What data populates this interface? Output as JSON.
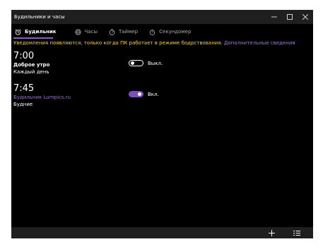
{
  "window": {
    "title": "Будильники и часы"
  },
  "tabs": [
    {
      "label": "Будильник",
      "icon": "alarm-clock-icon",
      "active": true
    },
    {
      "label": "Часы",
      "icon": "world-clock-icon",
      "active": false
    },
    {
      "label": "Таймер",
      "icon": "timer-icon",
      "active": false
    },
    {
      "label": "Секундомер",
      "icon": "stopwatch-icon",
      "active": false
    }
  ],
  "notice": {
    "text": "Уведомления появляются, только когда ПК работает в режиме бодрствования.",
    "link": "Дополнительные сведения"
  },
  "alarms": [
    {
      "time": "7:00",
      "name": "Доброе утро",
      "days": "Каждый день",
      "enabled": false,
      "toggle_label": "Выкл."
    },
    {
      "time": "7:45",
      "name": "Будильник Lumpics.ru",
      "days": "Будние",
      "enabled": true,
      "toggle_label": "Вкл."
    }
  ],
  "bottombar": {
    "add_icon": "plus-icon",
    "select_icon": "select-list-icon"
  },
  "colors": {
    "accent": "#7a4fc0",
    "notice": "#f2d033",
    "link": "#9f7bd6",
    "background": "#000000"
  }
}
